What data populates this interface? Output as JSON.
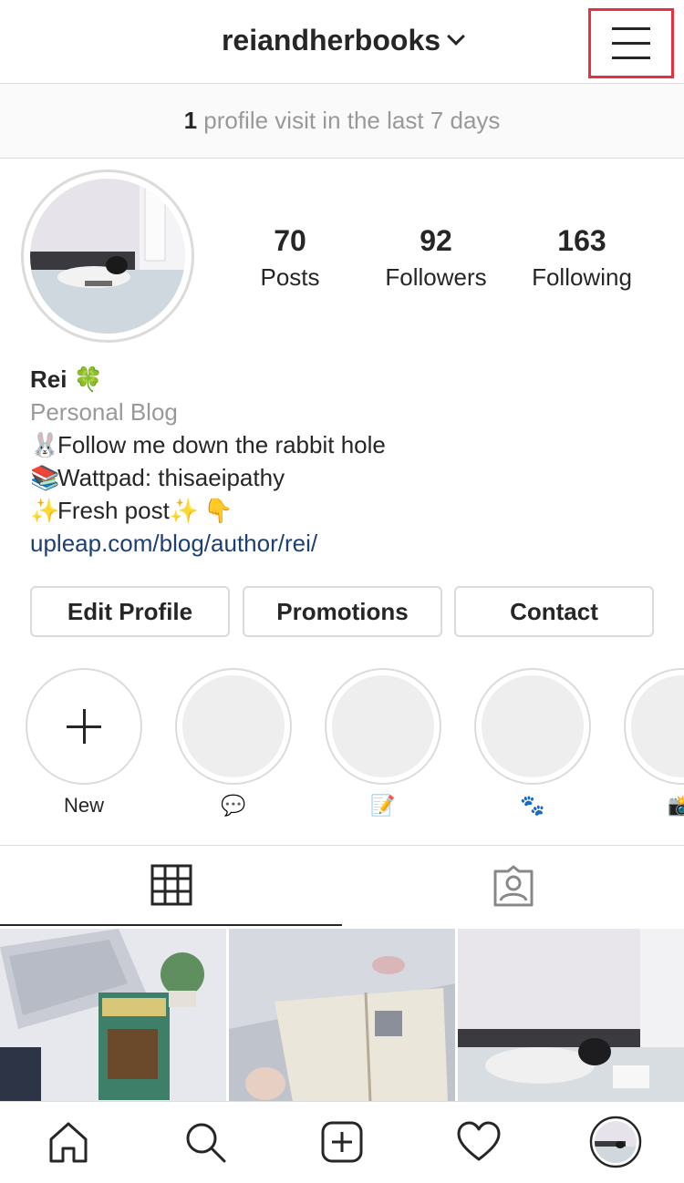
{
  "header": {
    "username": "reiandherbooks"
  },
  "visits": {
    "count": "1",
    "text": " profile visit in the last 7 days"
  },
  "stats": [
    {
      "value": "70",
      "label": "Posts"
    },
    {
      "value": "92",
      "label": "Followers"
    },
    {
      "value": "163",
      "label": "Following"
    }
  ],
  "bio": {
    "name": "Rei",
    "name_emoji": "🍀",
    "category": "Personal Blog",
    "line1_emoji": "🐰",
    "line1": "Follow me down the rabbit hole",
    "line2_emoji": "📚",
    "line2": "Wattpad: thisaeipathy",
    "line3_emoji_a": "✨",
    "line3": "Fresh post",
    "line3_emoji_b": "✨",
    "line3_emoji_c": "👇",
    "link": "upleap.com/blog/author/rei/"
  },
  "buttons": {
    "edit": "Edit Profile",
    "promotions": "Promotions",
    "contact": "Contact"
  },
  "highlights": [
    {
      "label": "New"
    },
    {
      "label": "💬"
    },
    {
      "label": "📝"
    },
    {
      "label": "🐾"
    },
    {
      "label": "📸"
    }
  ],
  "colors": {
    "accent_link": "#1d3f74",
    "highlight_box": "#e8303e",
    "border": "#dbdbdb",
    "muted_text": "#999999"
  },
  "icons": {
    "menu": "hamburger-menu-icon",
    "grid_tab": "grid-icon",
    "tagged_tab": "tagged-person-icon",
    "nav": [
      "home-icon",
      "search-icon",
      "add-post-icon",
      "heart-icon",
      "profile-avatar"
    ]
  }
}
